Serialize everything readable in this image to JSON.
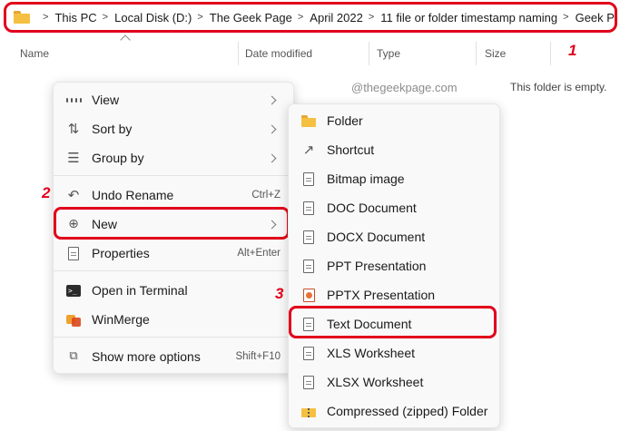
{
  "breadcrumb": [
    "This PC",
    "Local Disk (D:)",
    "The Geek Page",
    "April 2022",
    "11 file or folder timestamp naming",
    "Geek Page Test"
  ],
  "columns": {
    "name": "Name",
    "date_modified": "Date modified",
    "type": "Type",
    "size": "Size"
  },
  "watermark": "@thegeekpage.com",
  "empty_message": "This folder is empty.",
  "annotations": {
    "step1": "1",
    "step2": "2",
    "step3": "3"
  },
  "accent_color": "#e1001a",
  "context_menu": {
    "view": "View",
    "sort_by": "Sort by",
    "group_by": "Group by",
    "undo_rename": "Undo Rename",
    "undo_shortcut": "Ctrl+Z",
    "new": "New",
    "properties": "Properties",
    "properties_shortcut": "Alt+Enter",
    "open_terminal": "Open in Terminal",
    "winmerge": "WinMerge",
    "show_more": "Show more options",
    "show_more_shortcut": "Shift+F10"
  },
  "new_submenu": {
    "folder": "Folder",
    "shortcut": "Shortcut",
    "bitmap": "Bitmap image",
    "doc": "DOC Document",
    "docx": "DOCX Document",
    "ppt": "PPT Presentation",
    "pptx": "PPTX Presentation",
    "text": "Text Document",
    "xls": "XLS Worksheet",
    "xlsx": "XLSX Worksheet",
    "zip": "Compressed (zipped) Folder"
  }
}
